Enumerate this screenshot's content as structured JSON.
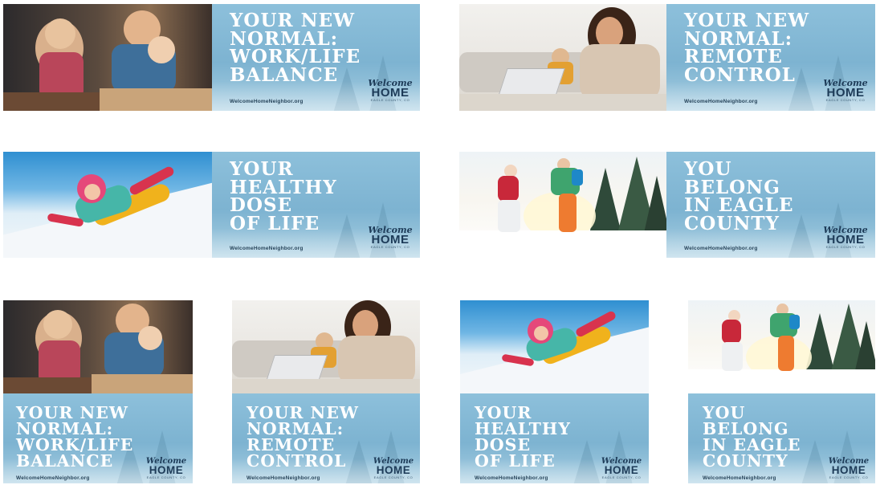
{
  "colors": {
    "panel_blue": "#7fb4d2",
    "headline_white": "#ffffff",
    "logo_navy": "#1d3b58",
    "url_navy": "#27445a"
  },
  "ads": {
    "work_life": {
      "headline": [
        "YOUR NEW",
        "NORMAL:",
        "WORK/LIFE",
        "BALANCE"
      ],
      "url": "WelcomeHomeNeighbor.org",
      "logo_script": "Welcome",
      "logo_word": "HOME",
      "logo_sub": "EAGLE COUNTY, CO"
    },
    "remote": {
      "headline": [
        "YOUR NEW",
        "NORMAL:",
        "REMOTE",
        "CONTROL"
      ],
      "url": "WelcomeHomeNeighbor.org",
      "logo_script": "Welcome",
      "logo_word": "HOME",
      "logo_sub": "EAGLE COUNTY, CO"
    },
    "healthy": {
      "headline": [
        "YOUR",
        "HEALTHY",
        "DOSE",
        "OF LIFE"
      ],
      "url": "WelcomeHomeNeighbor.org",
      "logo_script": "Welcome",
      "logo_word": "HOME",
      "logo_sub": "EAGLE COUNTY, CO"
    },
    "belong": {
      "headline": [
        "YOU",
        "BELONG",
        "IN EAGLE",
        "COUNTY"
      ],
      "url": "WelcomeHomeNeighbor.org",
      "logo_script": "Welcome",
      "logo_word": "HOME",
      "logo_sub": "EAGLE COUNTY, CO"
    }
  },
  "photos": {
    "work_life": "family-baking-photo",
    "remote": "woman-laptop-photo",
    "healthy": "child-sledding-photo",
    "belong": "snowshoers-photo"
  }
}
